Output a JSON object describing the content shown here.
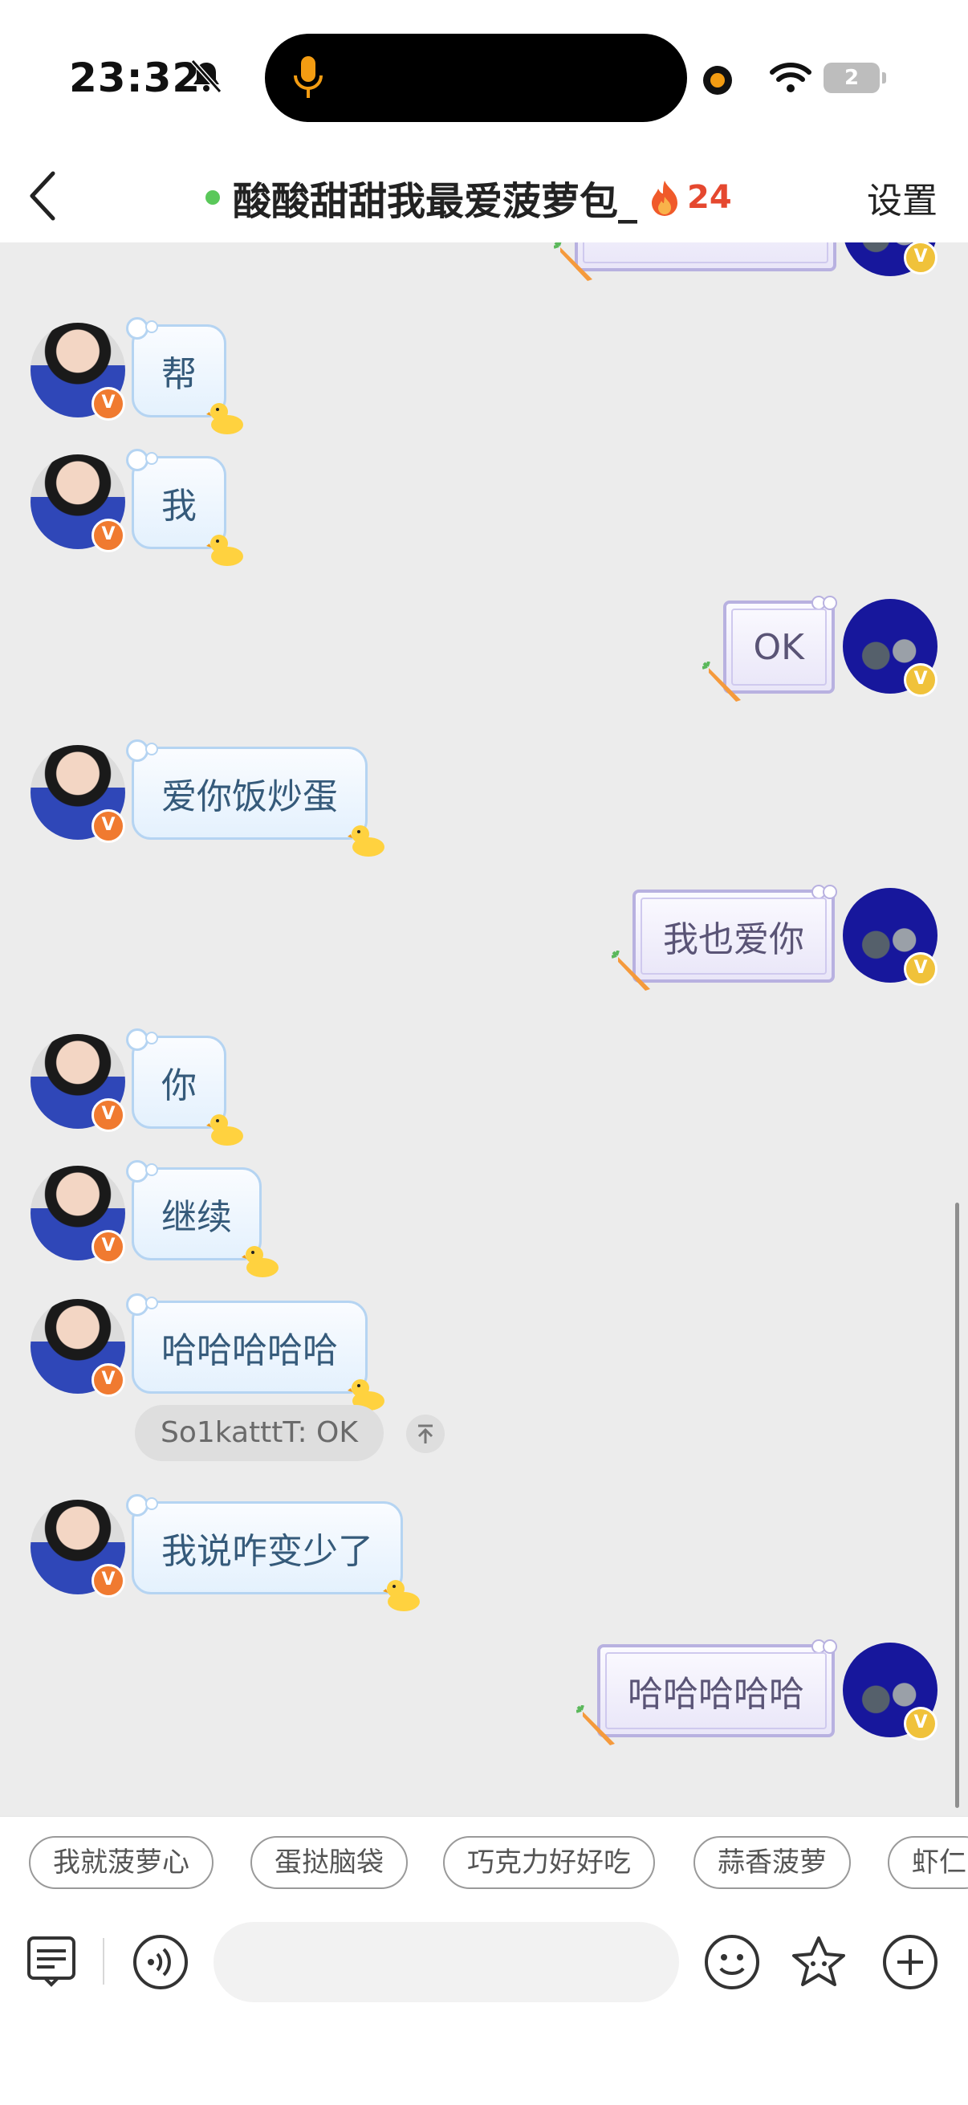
{
  "status_bar": {
    "time": "23:32",
    "battery": "2"
  },
  "header": {
    "title": "酸酸甜甜我最爱菠萝包_",
    "streak": "24",
    "settings_label": "设置"
  },
  "messages": [
    {
      "side": "left",
      "text": "帮"
    },
    {
      "side": "left",
      "text": "我"
    },
    {
      "side": "right",
      "text": "OK"
    },
    {
      "side": "left",
      "text": "爱你饭炒蛋"
    },
    {
      "side": "right",
      "text": "我也爱你"
    },
    {
      "side": "left",
      "text": "你"
    },
    {
      "side": "left",
      "text": "继续"
    },
    {
      "side": "left",
      "text": "哈哈哈哈哈"
    },
    {
      "side": "left",
      "text": "我说咋变少了"
    },
    {
      "side": "right",
      "text": "哈哈哈哈哈"
    }
  ],
  "quote": {
    "text": "So1katttT: OK"
  },
  "quick_replies": [
    "我就菠萝心",
    "蛋挞脑袋",
    "巧克力好好吃",
    "蒜香菠萝",
    "虾仁"
  ],
  "input": {
    "placeholder": ""
  },
  "colors": {
    "accent_streak": "#e5482f",
    "online": "#5ac85a",
    "left_bubble_border": "#b5d4f2",
    "right_bubble_border": "#b8b1e0"
  },
  "icons": [
    "back-icon",
    "fire-icon",
    "bell-muted-icon",
    "mic-icon",
    "wifi-icon",
    "duck-icon",
    "carrot-icon",
    "document-icon",
    "voice-icon",
    "emoji-icon",
    "star-icon",
    "plus-icon"
  ]
}
